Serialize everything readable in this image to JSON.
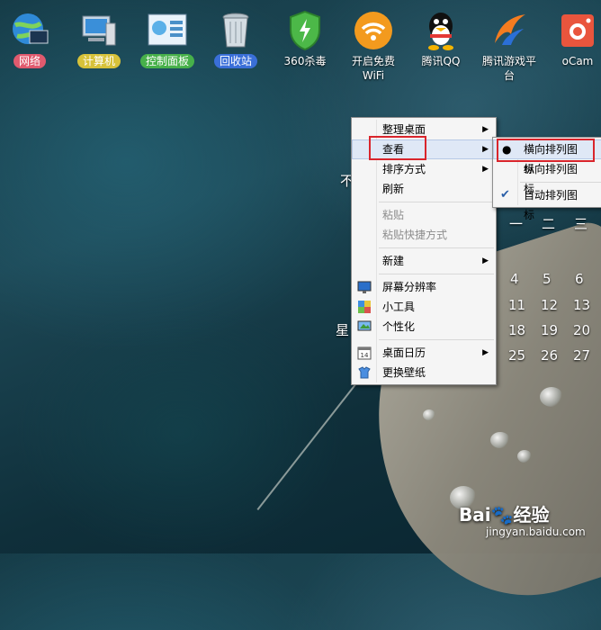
{
  "desktop_icons": [
    {
      "label": "网络",
      "icon": "network-globe-icon",
      "badge_color": "#e05a6e"
    },
    {
      "label": "计算机",
      "icon": "computer-icon",
      "badge_color": "#d7c23a"
    },
    {
      "label": "控制面板",
      "icon": "control-panel-icon",
      "badge_color": "#47b04a"
    },
    {
      "label": "回收站",
      "icon": "recycle-bin-icon",
      "badge_color": "#3a6fd8"
    },
    {
      "label": "360杀毒",
      "icon": "shield-icon"
    },
    {
      "label": "开启免费WiFi",
      "icon": "wifi-icon"
    },
    {
      "label": "腾讯QQ",
      "icon": "qq-penguin-icon"
    },
    {
      "label": "腾讯游戏平台",
      "icon": "tencent-game-icon"
    },
    {
      "label": "oCam",
      "icon": "camera-icon"
    }
  ],
  "calendar": {
    "weekday_header": [
      "一",
      "二",
      "三"
    ],
    "rows": [
      [
        "4",
        "5",
        "6"
      ],
      [
        "11",
        "12",
        "13"
      ],
      [
        "18",
        "19",
        "20"
      ],
      [
        "25",
        "26",
        "27"
      ]
    ],
    "side_char_1": "不",
    "side_char_2": "星"
  },
  "context_menu": {
    "items": [
      {
        "label": "整理桌面",
        "submenu": true
      },
      {
        "label": "查看",
        "submenu": true,
        "highlighted": true
      },
      {
        "label": "排序方式",
        "submenu": true
      },
      {
        "label": "刷新"
      },
      {
        "label": "粘贴",
        "disabled": true
      },
      {
        "label": "粘贴快捷方式",
        "disabled": true
      },
      {
        "label": "新建",
        "submenu": true
      },
      {
        "label": "屏幕分辨率",
        "icon": "monitor-icon"
      },
      {
        "label": "小工具",
        "icon": "gadgets-icon"
      },
      {
        "label": "个性化",
        "icon": "personalize-icon"
      },
      {
        "label": "桌面日历",
        "icon": "calendar-icon",
        "submenu": true
      },
      {
        "label": "更换壁纸",
        "icon": "wallpaper-icon"
      }
    ]
  },
  "view_submenu": {
    "items": [
      {
        "label": "横向排列图标",
        "marker": "bullet",
        "highlighted": true
      },
      {
        "label": "纵向排列图标"
      },
      {
        "label": "自动排列图标",
        "marker": "check"
      }
    ]
  },
  "watermark": {
    "brand": "Bai",
    "suffix": "经验",
    "url": "jingyan.baidu.com"
  }
}
